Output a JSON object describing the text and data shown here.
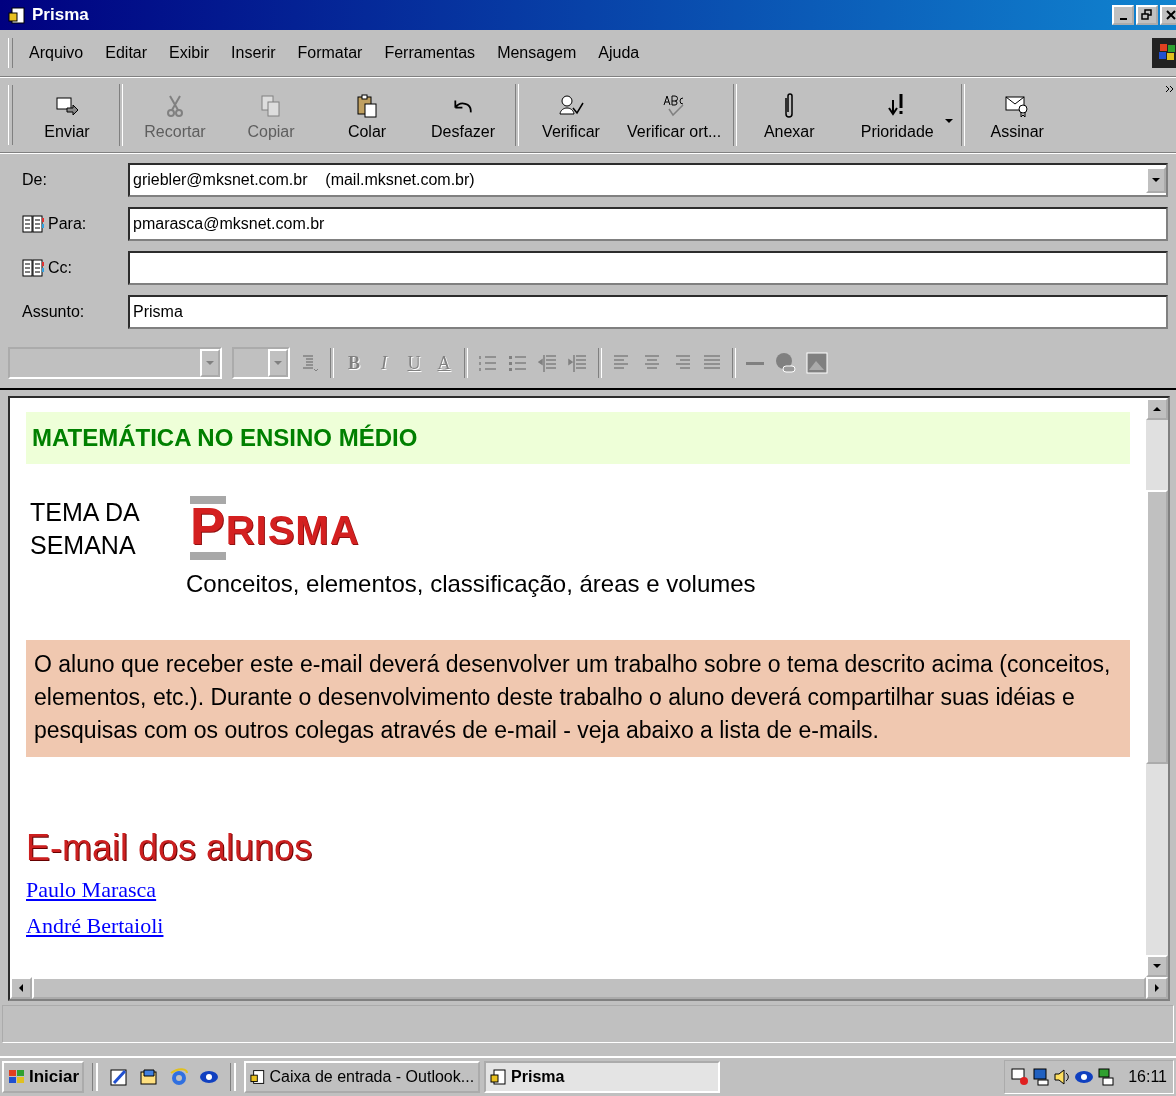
{
  "window": {
    "title": "Prisma"
  },
  "menu": [
    "Arquivo",
    "Editar",
    "Exibir",
    "Inserir",
    "Formatar",
    "Ferramentas",
    "Mensagem",
    "Ajuda"
  ],
  "toolbar": [
    {
      "buttons": [
        {
          "label": "Enviar",
          "kind": "send",
          "disabled": false
        }
      ]
    },
    {
      "buttons": [
        {
          "label": "Recortar",
          "kind": "cut",
          "disabled": true
        },
        {
          "label": "Copiar",
          "kind": "copy",
          "disabled": true
        },
        {
          "label": "Colar",
          "kind": "paste",
          "disabled": false
        },
        {
          "label": "Desfazer",
          "kind": "undo",
          "disabled": false
        }
      ]
    },
    {
      "buttons": [
        {
          "label": "Verificar",
          "kind": "check",
          "disabled": false
        },
        {
          "label": "Verificar ort...",
          "kind": "spell",
          "disabled": false
        }
      ]
    },
    {
      "buttons": [
        {
          "label": "Anexar",
          "kind": "attach",
          "disabled": false
        },
        {
          "label": "Prioridade",
          "kind": "priority",
          "disabled": false
        }
      ]
    },
    {
      "buttons": [
        {
          "label": "Assinar",
          "kind": "sign",
          "disabled": false
        }
      ]
    }
  ],
  "fields": [
    {
      "label": "De:",
      "kind": "dropdown",
      "value": "griebler@mksnet.com.br    (mail.mksnet.com.br)"
    },
    {
      "label": "Para:",
      "kind": "address",
      "value": "pmarasca@mksnet.com.br"
    },
    {
      "label": "Cc:",
      "kind": "address"
    },
    {
      "label": "Assunto:",
      "kind": "plain",
      "value": "Prisma"
    }
  ],
  "format_buttons": [
    "B",
    "I",
    "U",
    "A"
  ],
  "body": {
    "heading": "MATEMÁTICA NO ENSINO MÉDIO",
    "theme_label": "TEMA DA SEMANA",
    "logo": "PRISMA",
    "subtitle": "Conceitos, elementos, classificação, áreas e volumes",
    "notice": "O aluno que receber este e-mail deverá desenvolver um trabalho sobre o tema descrito acima (conceitos, elementos, etc.). Durante o desenvolvimento deste trabalho o aluno deverá compartilhar suas idéias e pesquisas com os outros colegas através de e-mail - veja abaixo a lista de e-mails.",
    "list_heading": "E-mail dos alunos",
    "links": [
      "Paulo Marasca",
      "André Bertaioli"
    ]
  },
  "taskbar": {
    "start": "Iniciar",
    "tasks": [
      {
        "label": "Caixa de entrada - Outlook...",
        "selected": false
      },
      {
        "label": "Prisma",
        "selected": true
      }
    ],
    "clock": "16:11"
  }
}
